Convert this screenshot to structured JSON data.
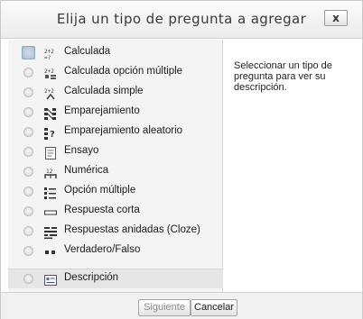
{
  "dialog": {
    "title": "Elija un tipo de pregunta a agregar",
    "close_label": "x"
  },
  "options": [
    {
      "label": "Calculada",
      "icon": "calculated-icon",
      "selected": true
    },
    {
      "label": "Calculada opción múltiple",
      "icon": "calculated-multichoice-icon",
      "selected": false
    },
    {
      "label": "Calculada simple",
      "icon": "calculated-simple-icon",
      "selected": false
    },
    {
      "label": "Emparejamiento",
      "icon": "matching-icon",
      "selected": false
    },
    {
      "label": "Emparejamiento aleatorio",
      "icon": "random-matching-icon",
      "selected": false
    },
    {
      "label": "Ensayo",
      "icon": "essay-icon",
      "selected": false
    },
    {
      "label": "Numérica",
      "icon": "numerical-icon",
      "selected": false
    },
    {
      "label": "Opción múltiple",
      "icon": "multichoice-icon",
      "selected": false
    },
    {
      "label": "Respuesta corta",
      "icon": "short-answer-icon",
      "selected": false
    },
    {
      "label": "Respuestas anidadas (Cloze)",
      "icon": "cloze-icon",
      "selected": false
    },
    {
      "label": "Verdadero/Falso",
      "icon": "truefalse-icon",
      "selected": false
    },
    {
      "label": "Descripción",
      "icon": "description-icon",
      "selected": false
    }
  ],
  "info": {
    "text": "Seleccionar un tipo de pregunta para ver su descripción."
  },
  "footer": {
    "next_label": "Siguiente",
    "cancel_label": "Cancelar"
  }
}
